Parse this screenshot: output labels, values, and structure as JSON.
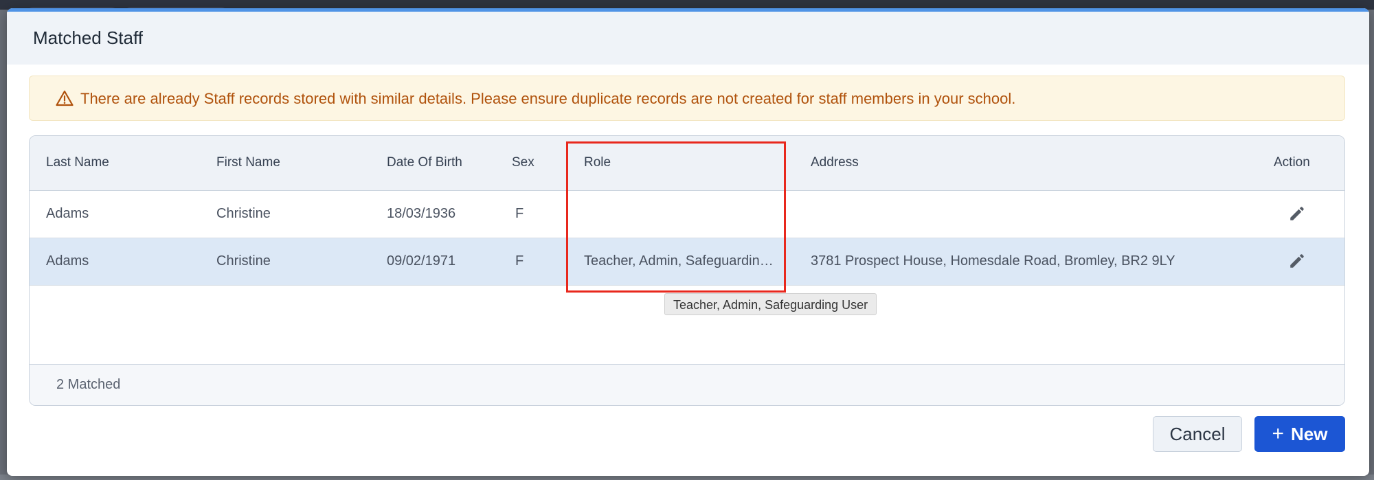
{
  "modal": {
    "title": "Matched Staff"
  },
  "alert": {
    "icon": "warning-triangle-icon",
    "message": "There are already Staff records stored with similar details. Please ensure duplicate records are not created for staff members in your school."
  },
  "table": {
    "columns": [
      "Last Name",
      "First Name",
      "Date Of Birth",
      "Sex",
      "Role",
      "Address",
      "Action"
    ],
    "rows": [
      {
        "last_name": "Adams",
        "first_name": "Christine",
        "dob": "18/03/1936",
        "sex": "F",
        "role": "",
        "address": "",
        "selected": false
      },
      {
        "last_name": "Adams",
        "first_name": "Christine",
        "dob": "09/02/1971",
        "sex": "F",
        "role": "Teacher, Admin, Safeguarding User",
        "address": "3781 Prospect House, Homesdale Road, Bromley, BR2 9LY",
        "selected": true
      }
    ],
    "footer": "2 Matched"
  },
  "tooltip": {
    "text": "Teacher, Admin, Safeguarding User"
  },
  "buttons": {
    "cancel_label": "Cancel",
    "new_icon": "+",
    "new_label": "New"
  },
  "colors": {
    "primary": "#1c56d4",
    "alert_text": "#b0520c",
    "alert_bg": "#fdf6e3",
    "highlight": "#e8281d",
    "selected_row": "#dce8f6"
  }
}
